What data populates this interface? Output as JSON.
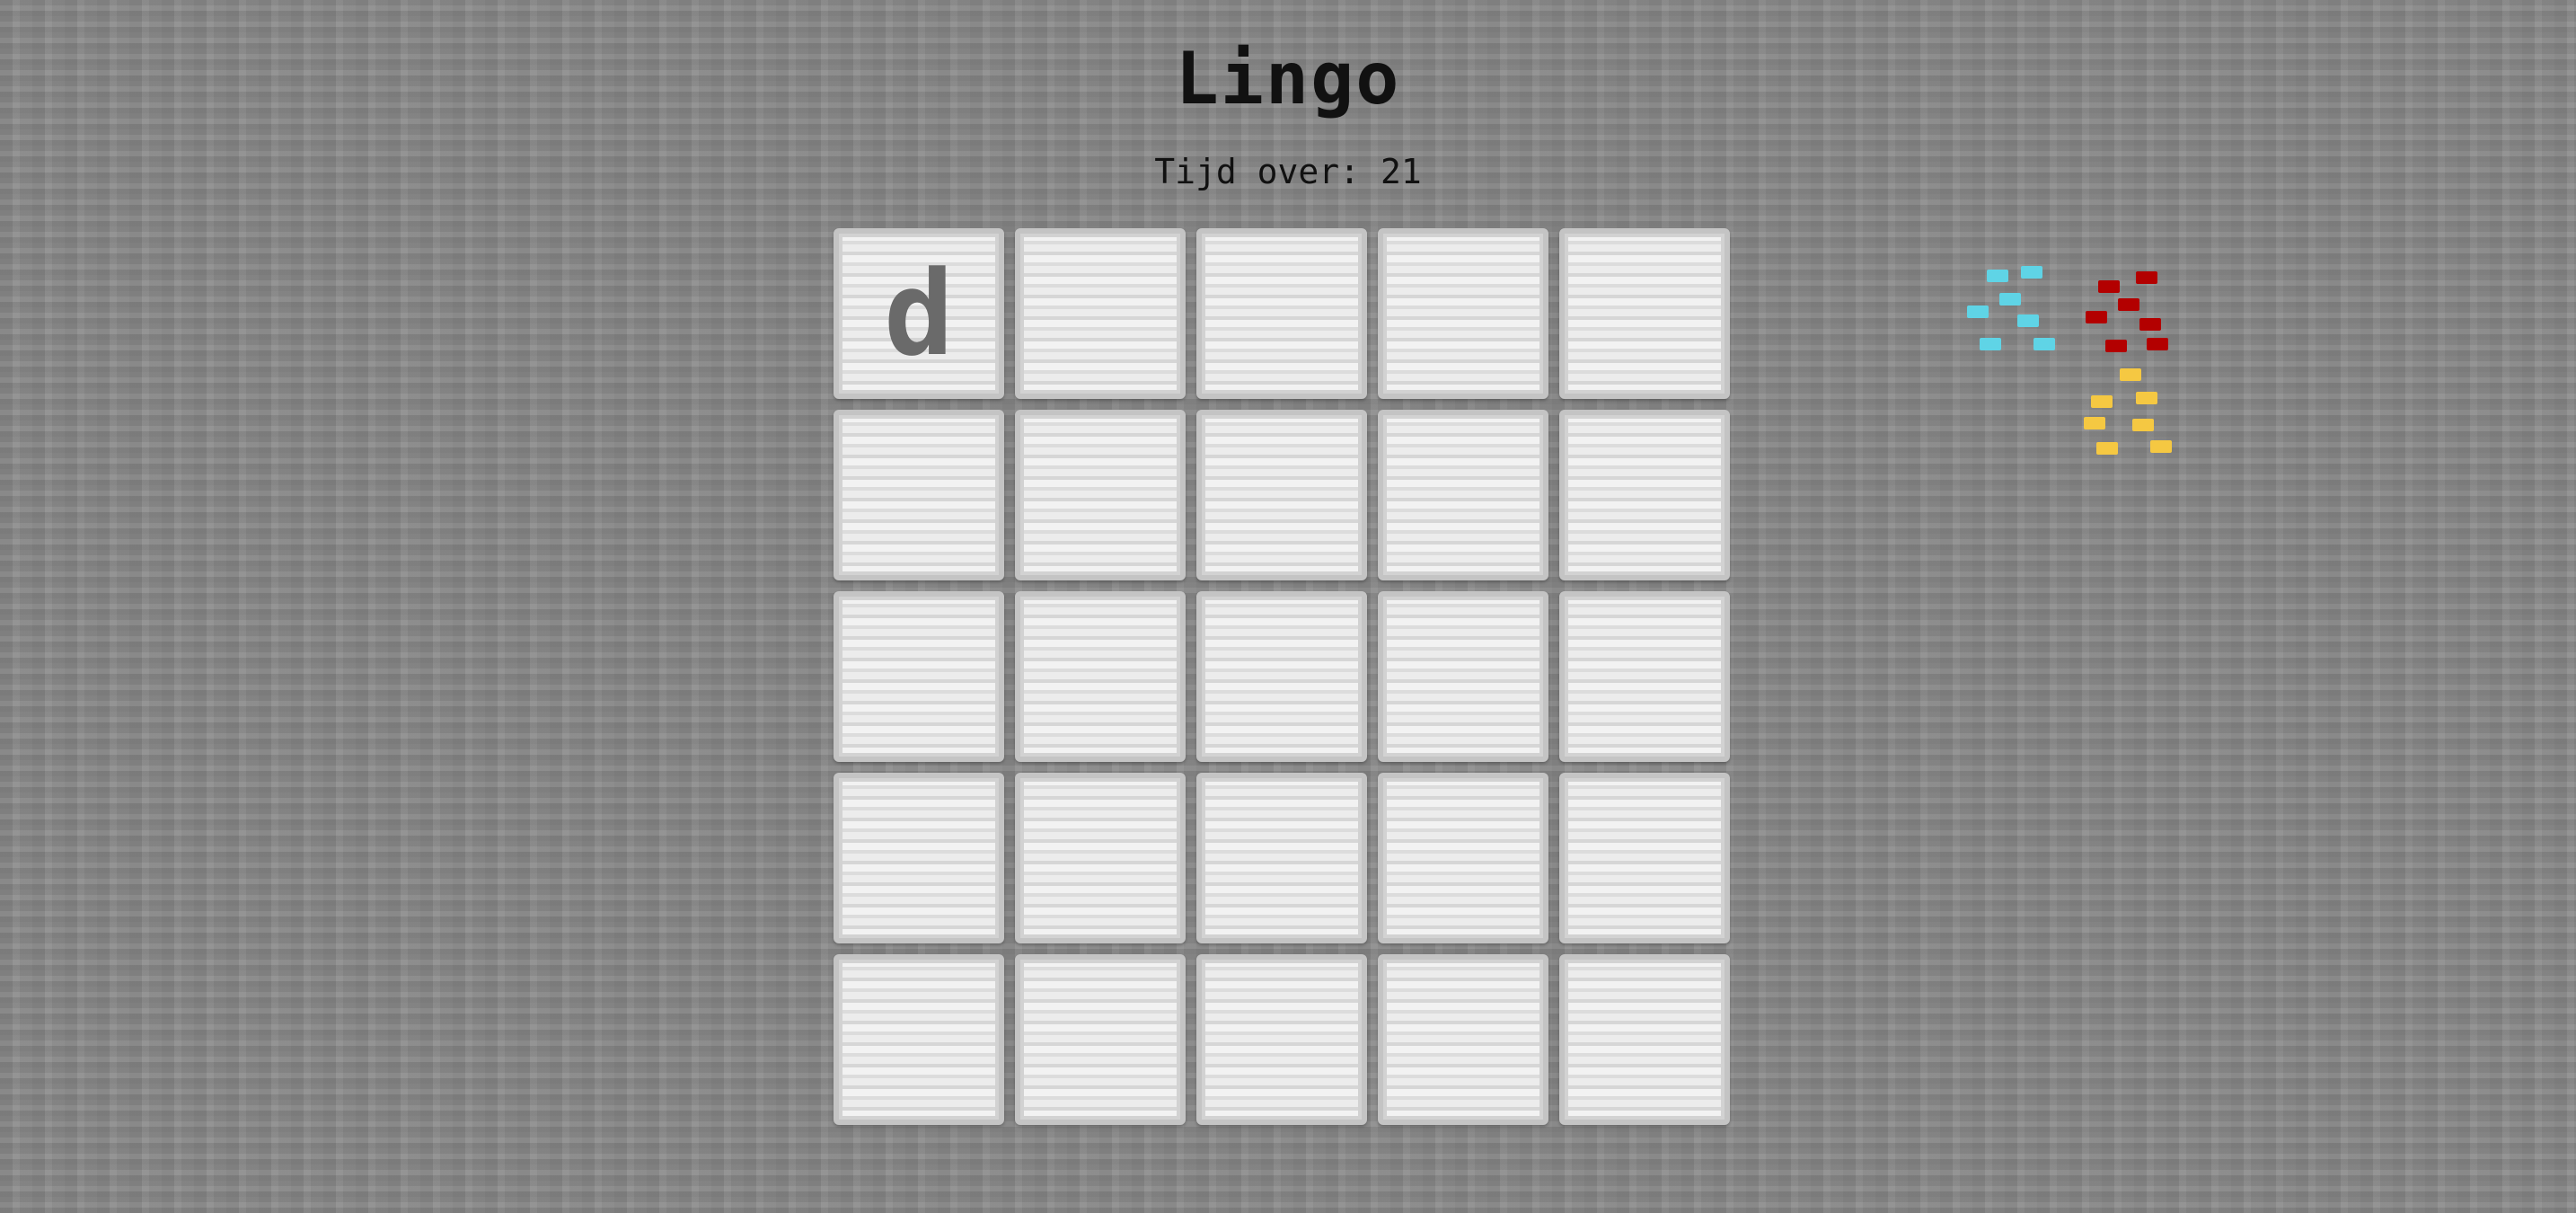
{
  "title": "Lingo",
  "timer": "Tijd over: 21",
  "board": {
    "rows": 5,
    "cols": 5,
    "cells": [
      [
        "d",
        "",
        "",
        "",
        ""
      ],
      [
        "",
        "",
        "",
        "",
        ""
      ],
      [
        "",
        "",
        "",
        "",
        ""
      ],
      [
        "",
        "",
        "",
        "",
        ""
      ],
      [
        "",
        "",
        "",
        "",
        ""
      ]
    ]
  },
  "ores": {
    "diamond_color": "#5fd4e6",
    "redstone_color": "#b30000",
    "gold_color": "#f5c842"
  }
}
